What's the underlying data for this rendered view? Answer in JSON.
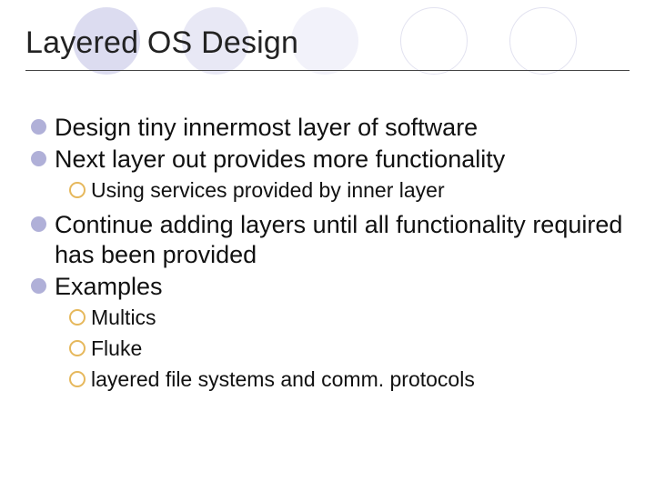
{
  "title": "Layered OS Design",
  "bullets": {
    "b1": "Design tiny innermost layer of software",
    "b2": "Next layer out provides more functionality",
    "b2_1": "Using services provided by inner layer",
    "b3": "Continue adding layers until all functionality required has been provided",
    "b4": "Examples",
    "b4_1": "Multics",
    "b4_2": "Fluke",
    "b4_3": "layered file systems and comm. protocols"
  }
}
